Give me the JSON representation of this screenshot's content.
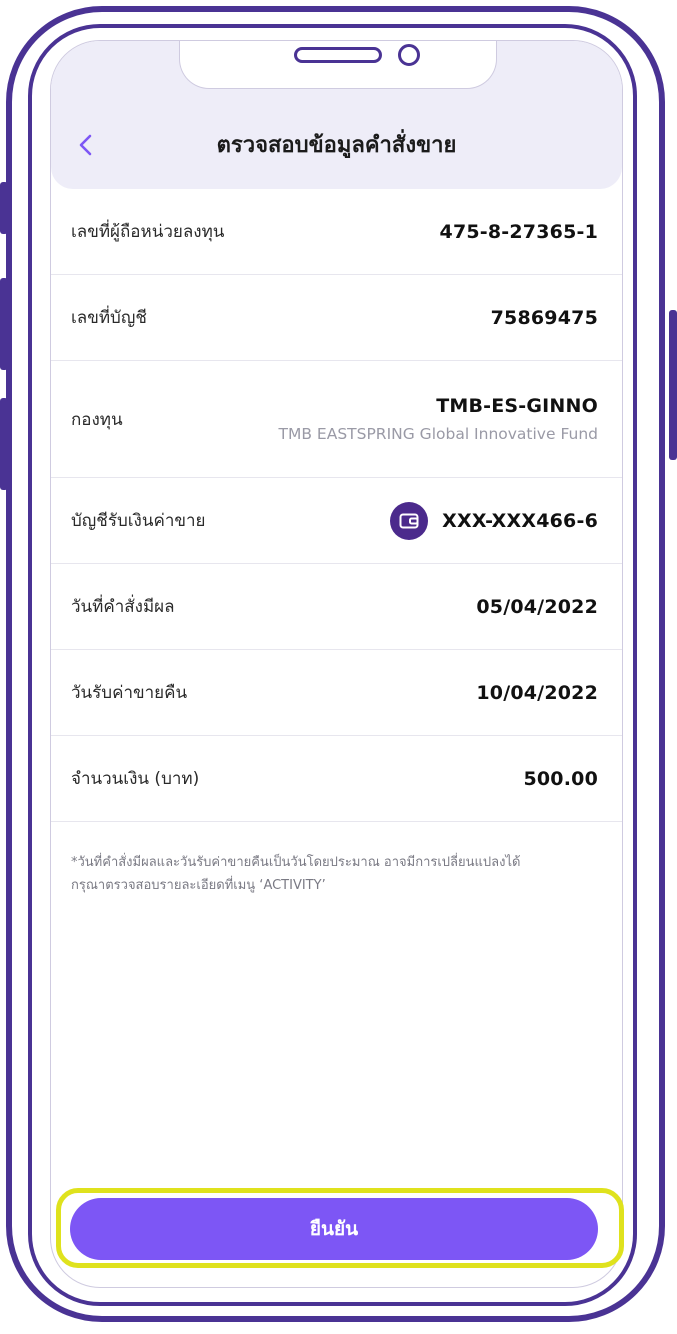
{
  "header": {
    "title": "ตรวจสอบข้อมูลคำสั่งขาย",
    "back_icon": "chevron-left-icon"
  },
  "rows": [
    {
      "label": "เลขที่ผู้ถือหน่วยลงทุน",
      "value": "475-8-27365-1"
    },
    {
      "label": "เลขที่บัญชี",
      "value": "75869475"
    },
    {
      "label": "กองทุน",
      "value": "TMB-ES-GINNO",
      "sub": "TMB EASTSPRING Global Innovative Fund"
    },
    {
      "label": "บัญชีรับเงินค่าขาย",
      "value": "XXX-XXX466-6",
      "icon": "wallet-icon"
    },
    {
      "label": "วันที่คำสั่งมีผล",
      "value": "05/04/2022"
    },
    {
      "label": "วันรับค่าขายคืน",
      "value": "10/04/2022"
    },
    {
      "label": "จำนวนเงิน (บาท)",
      "value": "500.00"
    }
  ],
  "note": {
    "line1": "*วันที่คำสั่งมีผลและวันรับค่าขายคืนเป็นวันโดยประมาณ อาจมีการเปลี่ยนแปลงได้",
    "line2": "กรุณาตรวจสอบรายละเอียดที่เมนู ‘ACTIVITY’"
  },
  "confirm_button": {
    "label": "ยืนยัน"
  },
  "colors": {
    "accent": "#7d56f5",
    "frame": "#4a3394",
    "highlight": "#dfe21d",
    "header_bg": "#eeedf8"
  }
}
